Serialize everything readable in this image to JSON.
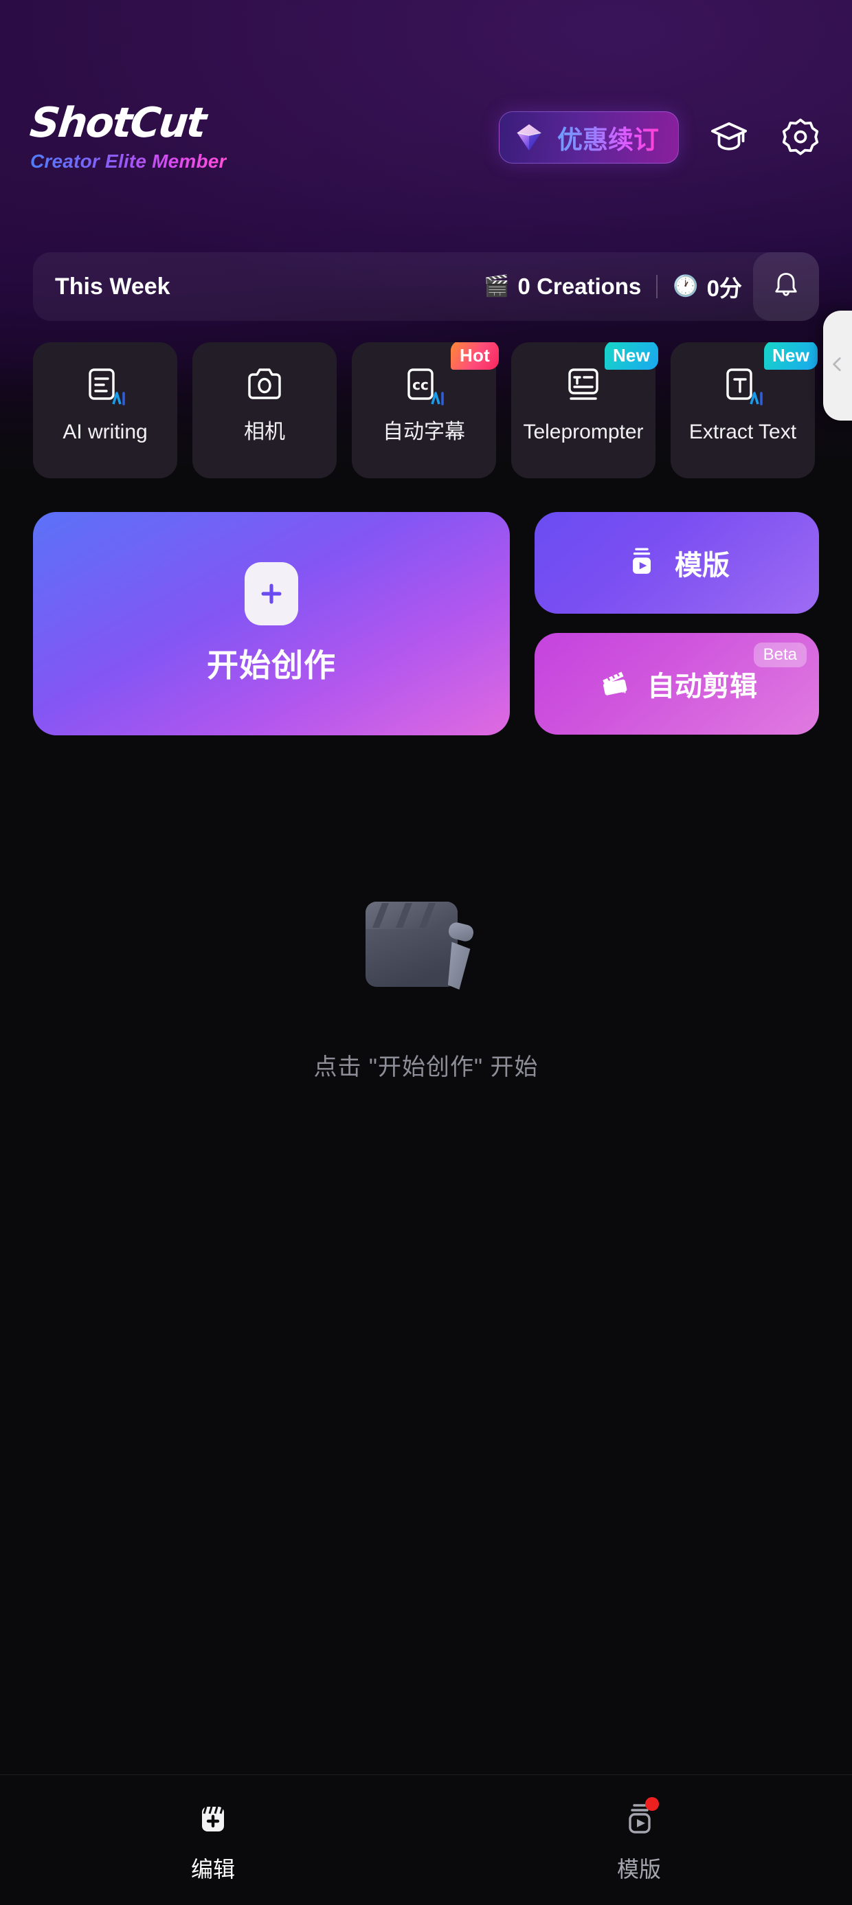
{
  "header": {
    "logo": "ShotCut",
    "membership": "Creator Elite Member",
    "subscribe_label": "优惠续订",
    "subscribe_icon": "gem-icon",
    "tutorial_icon": "graduation-cap-icon",
    "settings_icon": "gear-icon",
    "accent_colors": {
      "gradient_start": "#6aa0ff",
      "gradient_mid": "#9f7bff",
      "gradient_end": "#ff3fd0",
      "header_bg": "#2b0c43",
      "page_bg": "#0a0a0c"
    }
  },
  "stats": {
    "period_label": "This Week",
    "creations": {
      "icon": "clapperboard-emoji",
      "glyph": "🎬",
      "text": "0 Creations"
    },
    "duration": {
      "icon": "clock-emoji",
      "glyph": "🕐",
      "text": "0分"
    },
    "notification_icon": "bell-icon"
  },
  "feature_chips": [
    {
      "label": "AI writing",
      "icon": "ai-writing-icon",
      "badge": null,
      "badge_type": null
    },
    {
      "label": "相机",
      "icon": "camera-icon",
      "badge": null,
      "badge_type": null
    },
    {
      "label": "自动字幕",
      "icon": "cc-ai-icon",
      "badge": "Hot",
      "badge_type": "hot"
    },
    {
      "label": "Teleprompter",
      "icon": "teleprompter-icon",
      "badge": "New",
      "badge_type": "new"
    },
    {
      "label": "Extract Text",
      "icon": "extract-text-icon",
      "badge": "New",
      "badge_type": "new"
    }
  ],
  "side_panel_tab": {
    "icon": "chevron-left-icon"
  },
  "actions": {
    "create": {
      "label": "开始创作",
      "icon": "plus-icon"
    },
    "template": {
      "label": "模版",
      "icon": "template-play-icon"
    },
    "auto_edit": {
      "label": "自动剪辑",
      "icon": "auto-edit-icon",
      "badge": "Beta"
    }
  },
  "empty_state": {
    "art": "clapperboard-3d-icon",
    "text": "点击 \"开始创作\" 开始"
  },
  "bottom_nav": [
    {
      "label": "编辑",
      "icon": "edit-clapper-plus-icon",
      "active": true,
      "dot": false
    },
    {
      "label": "模版",
      "icon": "template-play-icon",
      "active": false,
      "dot": true
    }
  ]
}
